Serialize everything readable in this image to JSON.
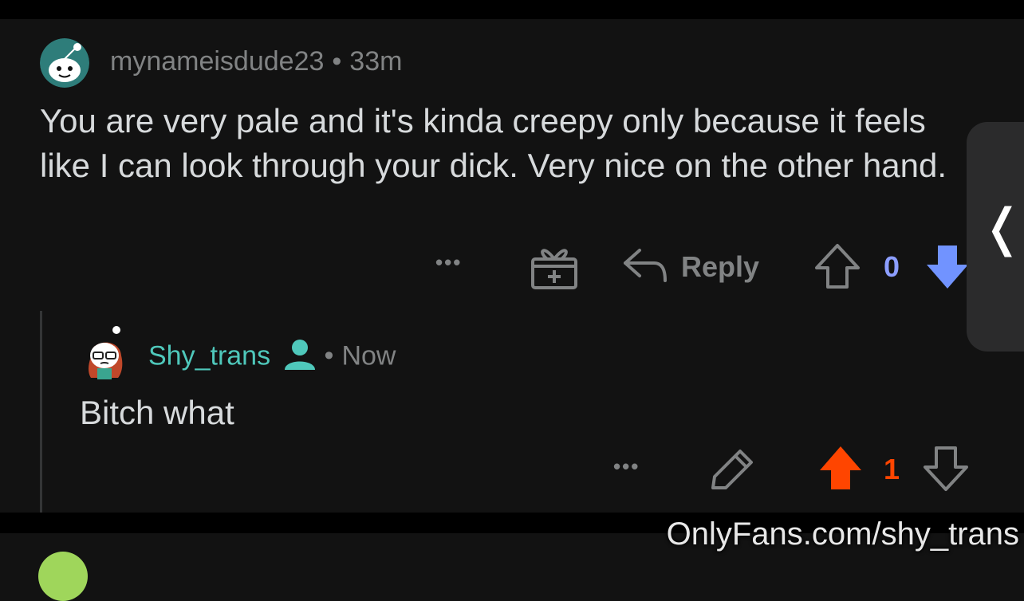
{
  "comment": {
    "username": "mynameisdude23",
    "separator": "•",
    "time": "33m",
    "body": "You are very pale and it's kinda creepy only because it feels like I can look through your dick. Very nice on the other hand.",
    "actions": {
      "more_label": "•••",
      "award_icon": "gift-icon",
      "reply_label": "Reply",
      "vote_count": "0"
    }
  },
  "reply": {
    "username": "Shy_trans",
    "op_icon": "person-icon",
    "separator": "•",
    "time": "Now",
    "body": "Bitch what",
    "actions": {
      "more_label": "•••",
      "edit_icon": "pencil-icon",
      "vote_count": "1"
    }
  },
  "side_tab": {
    "chevron": "❬"
  },
  "watermark": "OnlyFans.com/shy_trans",
  "colors": {
    "background": "#121212",
    "text": "#d7dadc",
    "meta": "#818384",
    "op_accent": "#4fc8bb",
    "downvote_active": "#7193ff",
    "vote_count_blue": "#8c9eff",
    "upvote_active": "#ff4500"
  }
}
